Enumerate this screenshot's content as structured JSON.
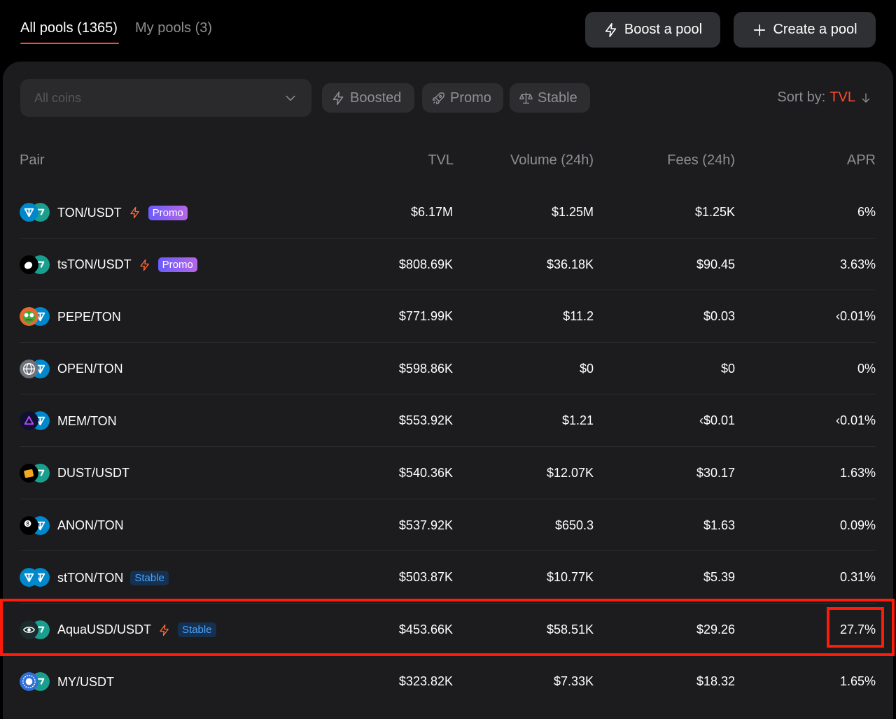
{
  "tabs": {
    "all": "All pools (1365)",
    "mine": "My pools (3)"
  },
  "actions": {
    "boost": "Boost a pool",
    "create": "Create a pool"
  },
  "filters": {
    "placeholder": "All coins",
    "boosted": "Boosted",
    "promo": "Promo",
    "stable": "Stable"
  },
  "sort": {
    "label": "Sort by:",
    "value": "TVL"
  },
  "columns": {
    "pair": "Pair",
    "tvl": "TVL",
    "volume": "Volume (24h)",
    "fees": "Fees (24h)",
    "apr": "APR"
  },
  "colors": {
    "accent": "#ff4b2e",
    "highlight": "#ff1a0a",
    "promo_badge": "#7a5cff",
    "stable_badge": "#4aa3ff"
  },
  "rows": [
    {
      "pair": "TON/USDT",
      "boosted": true,
      "badge": "Promo",
      "tvl": "$6.17M",
      "volume": "$1.25M",
      "fees": "$1.25K",
      "apr": "6%",
      "icons": [
        "ton-icon",
        "usdt-icon"
      ]
    },
    {
      "pair": "tsTON/USDT",
      "boosted": true,
      "badge": "Promo",
      "tvl": "$808.69K",
      "volume": "$36.18K",
      "fees": "$90.45",
      "apr": "3.63%",
      "icons": [
        "tston-icon",
        "usdt-icon"
      ]
    },
    {
      "pair": "PEPE/TON",
      "boosted": false,
      "badge": "",
      "tvl": "$771.99K",
      "volume": "$11.2",
      "fees": "$0.03",
      "apr": "‹0.01%",
      "icons": [
        "pepe-icon",
        "ton-icon"
      ]
    },
    {
      "pair": "OPEN/TON",
      "boosted": false,
      "badge": "",
      "tvl": "$598.86K",
      "volume": "$0",
      "fees": "$0",
      "apr": "0%",
      "icons": [
        "globe-icon",
        "ton-icon"
      ]
    },
    {
      "pair": "MEM/TON",
      "boosted": false,
      "badge": "",
      "tvl": "$553.92K",
      "volume": "$1.21",
      "fees": "‹$0.01",
      "apr": "‹0.01%",
      "icons": [
        "mem-icon",
        "ton-icon"
      ]
    },
    {
      "pair": "DUST/USDT",
      "boosted": false,
      "badge": "",
      "tvl": "$540.36K",
      "volume": "$12.07K",
      "fees": "$30.17",
      "apr": "1.63%",
      "icons": [
        "dust-icon",
        "usdt-icon"
      ]
    },
    {
      "pair": "ANON/TON",
      "boosted": false,
      "badge": "",
      "tvl": "$537.92K",
      "volume": "$650.3",
      "fees": "$1.63",
      "apr": "0.09%",
      "icons": [
        "eight-ball-icon",
        "ton-icon"
      ]
    },
    {
      "pair": "stTON/TON",
      "boosted": false,
      "badge": "Stable",
      "tvl": "$503.87K",
      "volume": "$10.77K",
      "fees": "$5.39",
      "apr": "0.31%",
      "icons": [
        "ton-icon",
        "ton-icon"
      ]
    },
    {
      "pair": "AquaUSD/USDT",
      "boosted": true,
      "badge": "Stable",
      "tvl": "$453.66K",
      "volume": "$58.51K",
      "fees": "$29.26",
      "apr": "27.7%",
      "icons": [
        "aquausd-icon",
        "usdt-icon"
      ]
    },
    {
      "pair": "MY/USDT",
      "boosted": false,
      "badge": "",
      "tvl": "$323.82K",
      "volume": "$7.33K",
      "fees": "$18.32",
      "apr": "1.65%",
      "icons": [
        "my-icon",
        "usdt-icon"
      ]
    }
  ]
}
